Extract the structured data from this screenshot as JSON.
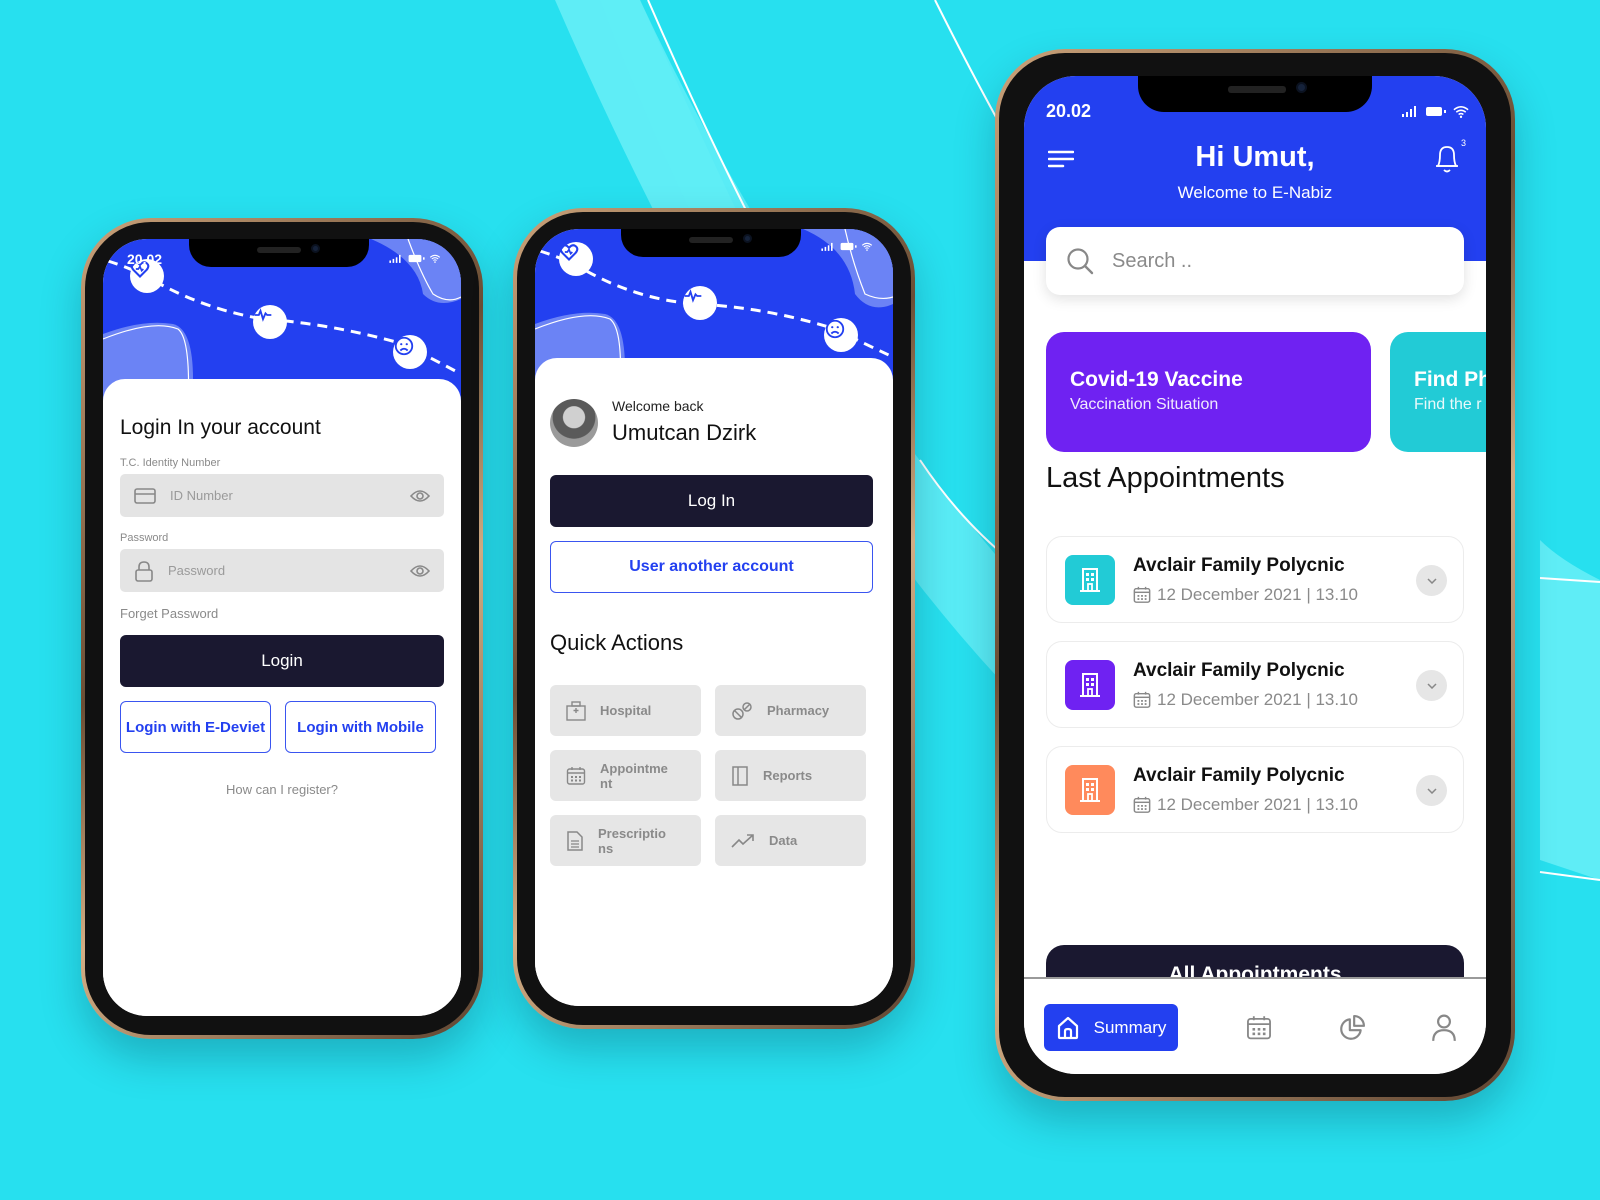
{
  "colors": {
    "background": "#27e0ef",
    "brand_blue": "#2340f0",
    "dark_button": "#1a1830",
    "vaccine_card": "#6f22f2",
    "find_card": "#22cbd6",
    "appt_teal": "#22cbd6",
    "appt_purple": "#6f22f2",
    "appt_orange": "#ff8a5c"
  },
  "status_bar": {
    "time": "20.02"
  },
  "login_screen": {
    "title": "Login In your account",
    "id_label": "T.C. Identity Number",
    "id_placeholder": "ID Number",
    "password_label": "Password",
    "password_placeholder": "Password",
    "forget_password": "Forget Password",
    "login_button": "Login",
    "login_edevlet": "Login with E-Deviet",
    "login_mobile": "Login with Mobile",
    "register_link": "How can I register?"
  },
  "welcome_screen": {
    "greeting": "Welcome back",
    "user_name": "Umutcan Dzirk",
    "login_button": "Log In",
    "other_account_button": "User another account",
    "quick_actions_title": "Quick Actions",
    "quick_actions": [
      {
        "label": "Hospital",
        "icon": "hospital-icon"
      },
      {
        "label": "Pharmacy",
        "icon": "pill-icon"
      },
      {
        "label": "Appointment",
        "icon": "calendar-icon"
      },
      {
        "label": "Reports",
        "icon": "book-icon"
      },
      {
        "label": "Prescriptions",
        "icon": "document-icon"
      },
      {
        "label": "Data",
        "icon": "trend-icon"
      }
    ]
  },
  "home_screen": {
    "greeting": "Hi Umut,",
    "subtitle": "Welcome to E-Nabiz",
    "notification_count": "3",
    "search_placeholder": "Search ..",
    "cards": [
      {
        "title": "Covid-19 Vaccine",
        "subtitle": "Vaccination Situation"
      },
      {
        "title": "Find Ph",
        "subtitle": "Find the r"
      }
    ],
    "appointments_title": "Last Appointments",
    "appointments": [
      {
        "name": "Avclair Family Polycnic",
        "datetime": "12 December 2021 | 13.10"
      },
      {
        "name": "Avclair Family Polycnic",
        "datetime": "12 December 2021 | 13.10"
      },
      {
        "name": "Avclair Family Polycnic",
        "datetime": "12 December 2021 | 13.10"
      }
    ],
    "all_appointments_button": "All Appointments",
    "tabs": [
      {
        "label": "Summary",
        "icon": "home-icon",
        "active": true
      },
      {
        "label": "",
        "icon": "calendar-icon",
        "active": false
      },
      {
        "label": "",
        "icon": "pie-chart-icon",
        "active": false
      },
      {
        "label": "",
        "icon": "user-icon",
        "active": false
      }
    ]
  }
}
